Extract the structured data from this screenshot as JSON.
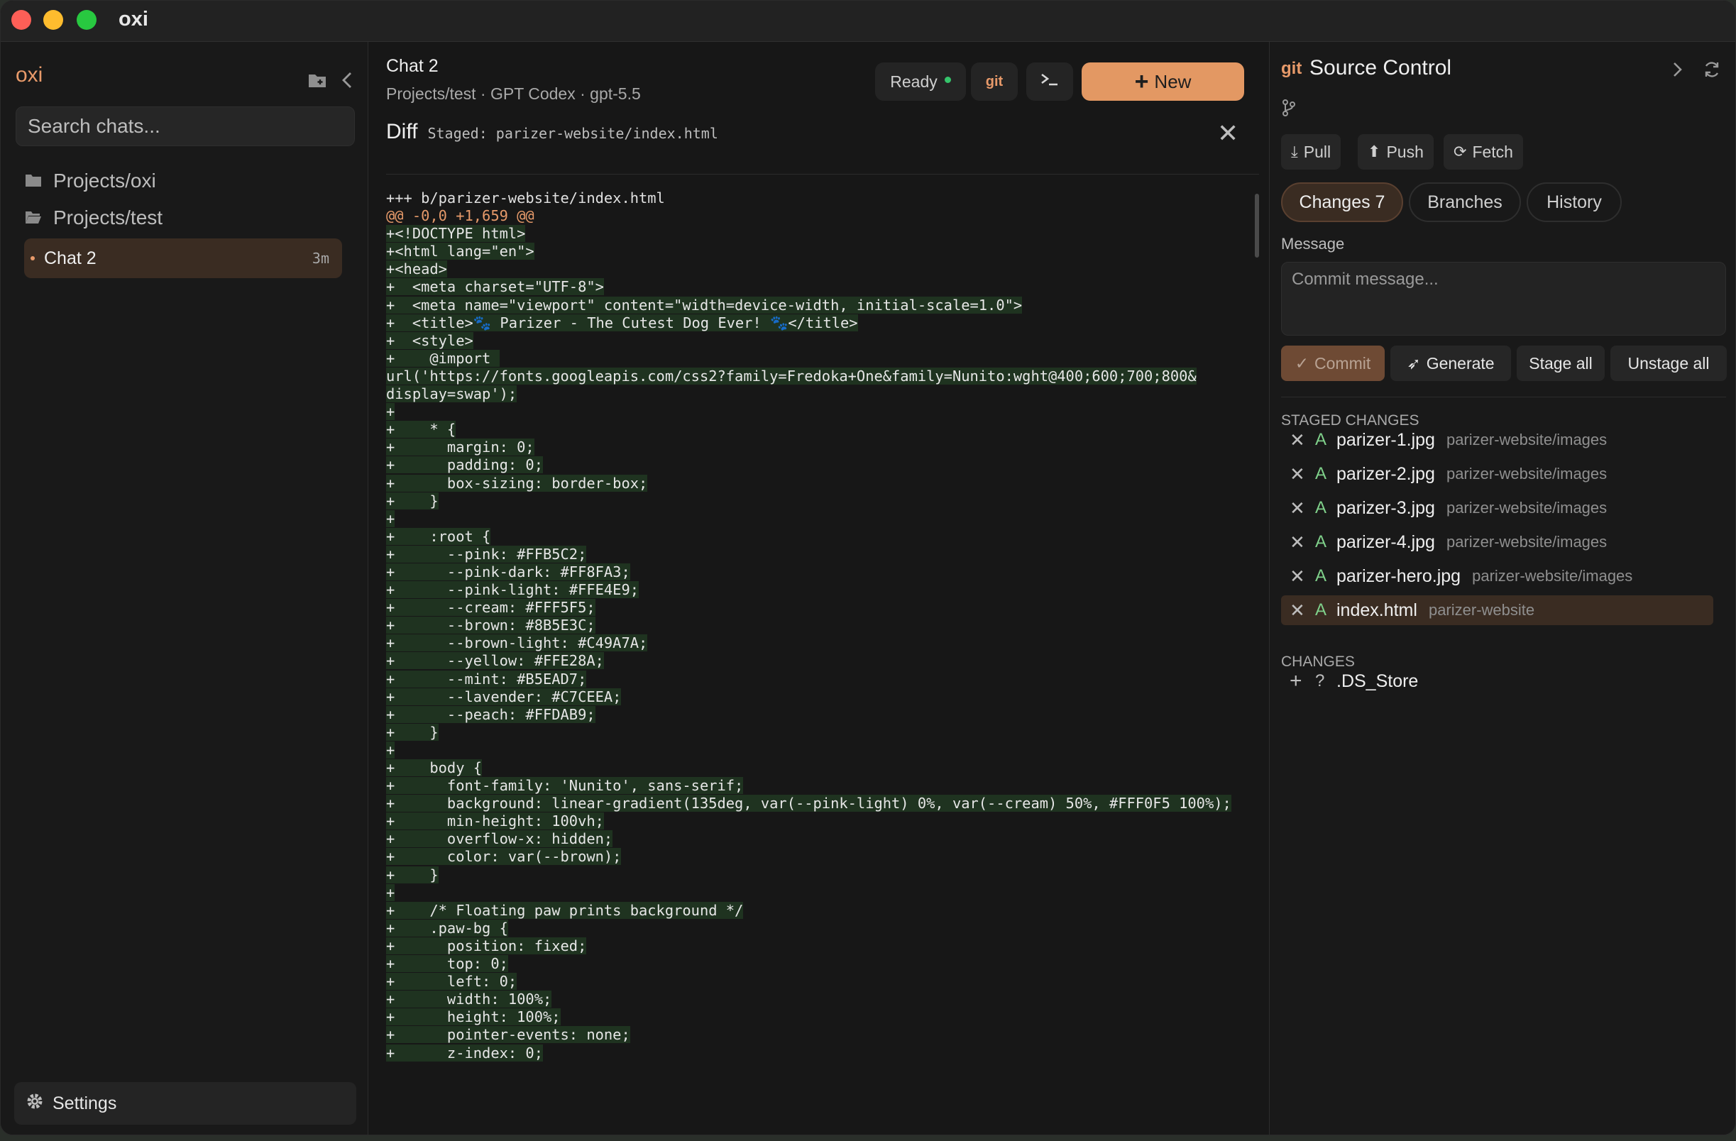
{
  "window": {
    "title": "oxi"
  },
  "sidebar": {
    "brand": "oxi",
    "search_placeholder": "Search chats...",
    "projects": [
      {
        "label": "Projects/oxi"
      },
      {
        "label": "Projects/test"
      }
    ],
    "active_chat": {
      "label": "Chat 2",
      "time": "3m"
    },
    "settings_label": "Settings"
  },
  "header": {
    "chat_title": "Chat 2",
    "chat_subtitle": "Projects/test · GPT Codex · gpt-5.5",
    "status_label": "Ready",
    "git_label": "git",
    "terminal_icon": "terminal-icon",
    "new_label": "New"
  },
  "diff": {
    "label": "Diff",
    "path": "Staged: parizer-website/index.html",
    "lines": [
      "+++ b/parizer-website/index.html",
      "@@ -0,0 +1,659 @@",
      "+<!DOCTYPE html>",
      "+<html lang=\"en\">",
      "+<head>",
      "+  <meta charset=\"UTF-8\">",
      "+  <meta name=\"viewport\" content=\"width=device-width, initial-scale=1.0\">",
      "+  <title>🐾 Parizer - The Cutest Dog Ever! 🐾</title>",
      "+  <style>",
      "+    @import ",
      "url('https://fonts.googleapis.com/css2?family=Fredoka+One&family=Nunito:wght@400;600;700;800&",
      "display=swap');",
      "+",
      "+    * {",
      "+      margin: 0;",
      "+      padding: 0;",
      "+      box-sizing: border-box;",
      "+    }",
      "+",
      "+    :root {",
      "+      --pink: #FFB5C2;",
      "+      --pink-dark: #FF8FA3;",
      "+      --pink-light: #FFE4E9;",
      "+      --cream: #FFF5F5;",
      "+      --brown: #8B5E3C;",
      "+      --brown-light: #C49A7A;",
      "+      --yellow: #FFE28A;",
      "+      --mint: #B5EAD7;",
      "+      --lavender: #C7CEEA;",
      "+      --peach: #FFDAB9;",
      "+    }",
      "+",
      "+    body {",
      "+      font-family: 'Nunito', sans-serif;",
      "+      background: linear-gradient(135deg, var(--pink-light) 0%, var(--cream) 50%, #FFF0F5 100%);",
      "+      min-height: 100vh;",
      "+      overflow-x: hidden;",
      "+      color: var(--brown);",
      "+    }",
      "+",
      "+    /* Floating paw prints background */",
      "+    .paw-bg {",
      "+      position: fixed;",
      "+      top: 0;",
      "+      left: 0;",
      "+      width: 100%;",
      "+      height: 100%;",
      "+      pointer-events: none;",
      "+      z-index: 0;"
    ]
  },
  "source_control": {
    "git_logo": "git",
    "title": "Source Control",
    "buttons": {
      "pull": "Pull",
      "push": "Push",
      "fetch": "Fetch"
    },
    "tabs": {
      "changes": "Changes 7",
      "branches": "Branches",
      "history": "History"
    },
    "message_label": "Message",
    "message_placeholder": "Commit message...",
    "actions": {
      "commit": "Commit",
      "generate": "Generate",
      "stage_all": "Stage all",
      "unstage_all": "Unstage all"
    },
    "staged_header": "STAGED CHANGES",
    "staged": [
      {
        "status": "A",
        "file": "parizer-1.jpg",
        "dir": "parizer-website/images"
      },
      {
        "status": "A",
        "file": "parizer-2.jpg",
        "dir": "parizer-website/images"
      },
      {
        "status": "A",
        "file": "parizer-3.jpg",
        "dir": "parizer-website/images"
      },
      {
        "status": "A",
        "file": "parizer-4.jpg",
        "dir": "parizer-website/images"
      },
      {
        "status": "A",
        "file": "parizer-hero.jpg",
        "dir": "parizer-website/images"
      },
      {
        "status": "A",
        "file": "index.html",
        "dir": "parizer-website"
      }
    ],
    "changes_header": "CHANGES",
    "changes": [
      {
        "status": "?",
        "file": ".DS_Store"
      }
    ]
  },
  "colors": {
    "accent": "#e39863",
    "added": "#7fd08a",
    "ready": "#35c46b"
  }
}
